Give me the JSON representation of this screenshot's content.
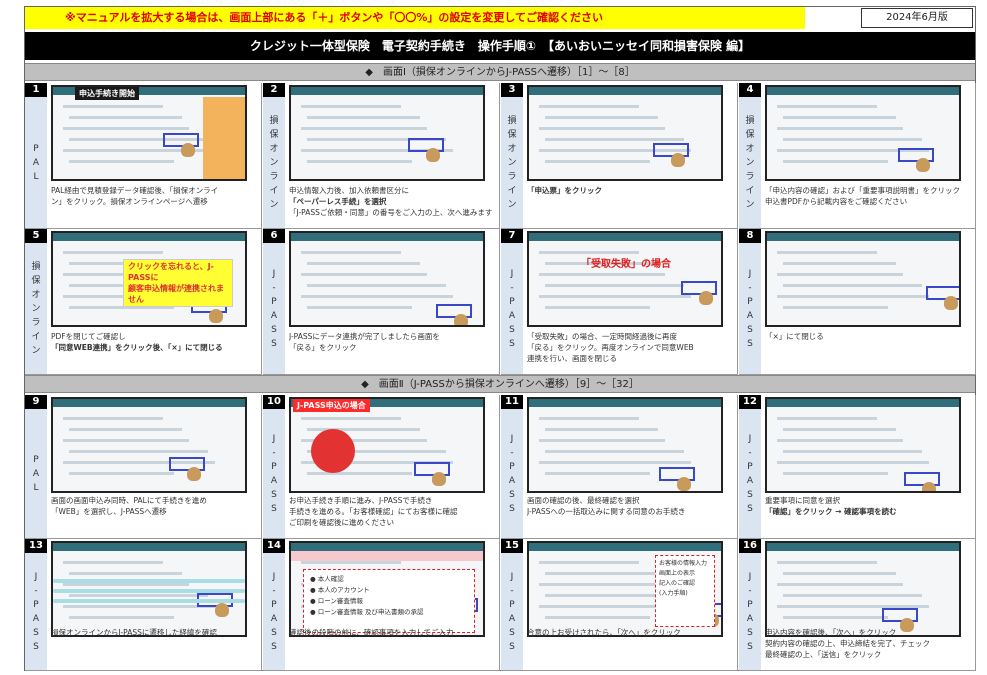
{
  "header": {
    "notice": "※マニュアルを拡大する場合は、画面上部にある「＋」ボタンや「〇〇%」の設定を変更してご確認ください",
    "date": "2024年6月版",
    "title": "クレジット一体型保険　電子契約手続き　操作手順①　【あいおいニッセイ同和損害保険 編】"
  },
  "sections": [
    {
      "label": "◆　画面Ⅰ（損保オンラインからJ-PASSへ遷移）［1］～［8］"
    },
    {
      "label": "◆　画面Ⅱ（J-PASSから損保オンラインへ遷移）［9］～［32］"
    }
  ],
  "steps": [
    {
      "num": "1",
      "side": "PAL",
      "tag": "申込手続き開始",
      "lines": [
        "PAL経由で見積登録データ確認後、「損保オンライ",
        "ン」をクリック。損保オンラインページへ遷移"
      ]
    },
    {
      "num": "2",
      "side": "損保オンライン",
      "lines": [
        "申込情報入力後、加入依頼書区分に",
        "「ペーパーレス手続」を選択",
        "「J-PASSご依頼・同意」の番号をご入力の上、次へ進みます"
      ],
      "bold": [
        1
      ]
    },
    {
      "num": "3",
      "side": "損保オンライン",
      "lines": [
        "「申込票」をクリック"
      ],
      "bold": [
        0
      ]
    },
    {
      "num": "4",
      "side": "損保オンライン",
      "lines": [
        "「申込内容の確認」および「重要事項説明書」をクリック",
        "申込書PDFから記載内容をご確認ください"
      ]
    },
    {
      "num": "5",
      "side": "損保オンライン",
      "note": [
        "クリックを忘れると、J-PASSに",
        "顧客申込情報が連携されません"
      ],
      "lines": [
        "PDFを閉じてご確認し",
        "「同意WEB連携」をクリック後、「×」にて閉じる"
      ],
      "bold": [
        1
      ]
    },
    {
      "num": "6",
      "side": "J-PASS",
      "lines": [
        "J-PASSにデータ連携が完了しましたら画面を",
        "「戻る」をクリック"
      ]
    },
    {
      "num": "7",
      "side": "J-PASS",
      "heading": "「受取失敗」の場合",
      "lines": [
        "「受取失敗」の場合、一定時間経過後に再度",
        "「戻る」をクリック。再度オンラインで同意WEB",
        "連携を行い、画面を閉じる"
      ]
    },
    {
      "num": "8",
      "side": "J-PASS",
      "lines": [
        "「×」にて閉じる"
      ]
    },
    {
      "num": "9",
      "side": "PAL",
      "lines": [
        "画面の画面申込み同時、PALにて手続きを進め",
        "「WEB」を選択し、J-PASSへ遷移"
      ]
    },
    {
      "num": "10",
      "side": "J-PASS",
      "tag": "J-PASS申込の場合",
      "lines": [
        "お申込手続き手順に進み、J-PASSで手続き",
        "手続きを進める。「お客様確認」にてお客様に確認",
        "ご印刷を確認後に進めください"
      ]
    },
    {
      "num": "11",
      "side": "J-PASS",
      "lines": [
        "画面の確認の後、最終確認を選択",
        "J-PASSへの一括取込みに関する同意のお手続き"
      ]
    },
    {
      "num": "12",
      "side": "J-PASS",
      "lines": [
        "重要事項に同意を選択",
        "「確認」をクリック → 確認事項を読む"
      ],
      "bold": [
        1
      ]
    },
    {
      "num": "13",
      "side": "J-PASS",
      "lines": [
        "損保オンラインからJ-PASSに遷移した経緯を確認"
      ]
    },
    {
      "num": "14",
      "side": "J-PASS",
      "list": [
        "本人確認",
        "本人のアカウント",
        "ローン審査情報",
        "ローン審査情報 及び申込書類の承認"
      ],
      "lines": [
        "確認後の段階の前に、確認事項を入力してご入力"
      ]
    },
    {
      "num": "15",
      "side": "J-PASS",
      "callout": [
        "お客様の情報入力",
        "画面上の表示",
        "記入のご確認",
        "(入力手順)"
      ],
      "lines": [
        "合意の上お受けされたら、「次へ」をクリック"
      ]
    },
    {
      "num": "16",
      "side": "J-PASS",
      "lines": [
        "申込内容を確認後、「次へ」をクリック",
        "契約内容の確認の上、申込締結を完了、チェック",
        "最終確認の上、「送信」をクリック"
      ]
    }
  ]
}
